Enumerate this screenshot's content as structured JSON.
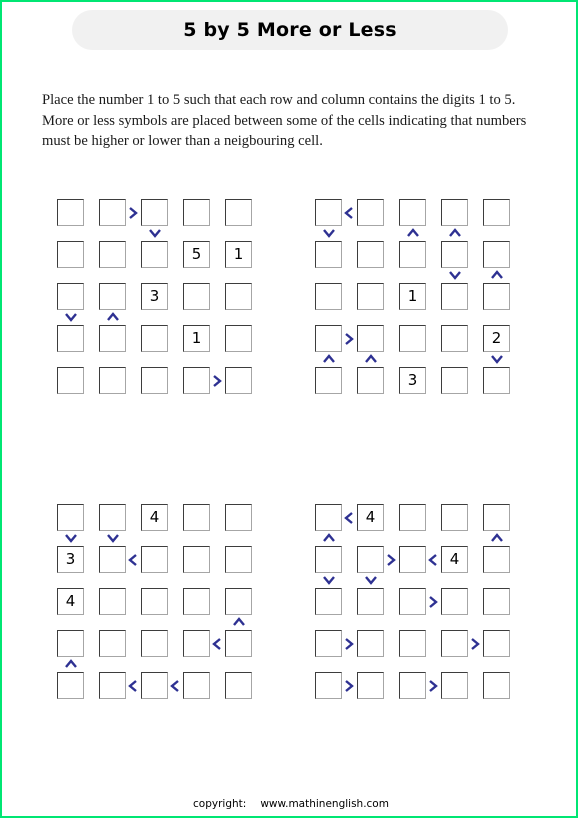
{
  "page": {
    "border_color": "#00e673",
    "background": "#ffffff"
  },
  "title": {
    "text": "5 by 5 More or Less",
    "pill_color": "#f1f1f1"
  },
  "instructions": {
    "text": "Place the number 1 to 5 such that each row and column contains the digits 1 to 5. More or less symbols are placed between some of the cells indicating that numbers must be higher or lower than a neigbouring cell."
  },
  "symbol_color": "#2e3192",
  "cell_border_color": "#3d3d3d",
  "footer": {
    "copyright_label": "copyright:",
    "site": "www.mathinenglish.com"
  },
  "puzzles": [
    {
      "id": "puzzle-top-left",
      "size": 5,
      "values": [
        [
          "",
          "",
          "",
          "",
          ""
        ],
        [
          "",
          "",
          "",
          "5",
          "1"
        ],
        [
          "",
          "",
          "3",
          "",
          ""
        ],
        [
          "",
          "",
          "",
          "1",
          ""
        ],
        [
          "",
          "",
          "",
          "",
          ""
        ]
      ],
      "h_symbols": [
        {
          "row": 0,
          "col": 1,
          "sym": "greater"
        },
        {
          "row": 4,
          "col": 3,
          "sym": "greater"
        }
      ],
      "v_symbols": [
        {
          "row": 0,
          "col": 2,
          "sym": "greater"
        },
        {
          "row": 2,
          "col": 0,
          "sym": "greater"
        },
        {
          "row": 2,
          "col": 1,
          "sym": "less"
        }
      ]
    },
    {
      "id": "puzzle-top-right",
      "size": 5,
      "values": [
        [
          "",
          "",
          "",
          "",
          ""
        ],
        [
          "",
          "",
          "",
          "",
          ""
        ],
        [
          "",
          "",
          "1",
          "",
          ""
        ],
        [
          "",
          "",
          "",
          "",
          "2"
        ],
        [
          "",
          "",
          "3",
          "",
          ""
        ]
      ],
      "h_symbols": [
        {
          "row": 0,
          "col": 0,
          "sym": "less"
        },
        {
          "row": 3,
          "col": 0,
          "sym": "greater"
        }
      ],
      "v_symbols": [
        {
          "row": 0,
          "col": 0,
          "sym": "greater"
        },
        {
          "row": 0,
          "col": 2,
          "sym": "less"
        },
        {
          "row": 0,
          "col": 3,
          "sym": "less"
        },
        {
          "row": 1,
          "col": 3,
          "sym": "greater"
        },
        {
          "row": 1,
          "col": 4,
          "sym": "less"
        },
        {
          "row": 3,
          "col": 0,
          "sym": "less"
        },
        {
          "row": 3,
          "col": 1,
          "sym": "less"
        },
        {
          "row": 3,
          "col": 4,
          "sym": "greater"
        }
      ]
    },
    {
      "id": "puzzle-bottom-left",
      "size": 5,
      "values": [
        [
          "",
          "",
          "4",
          "",
          ""
        ],
        [
          "3",
          "",
          "",
          "",
          ""
        ],
        [
          "4",
          "",
          "",
          "",
          ""
        ],
        [
          "",
          "",
          "",
          "",
          ""
        ],
        [
          "",
          "",
          "",
          "",
          ""
        ]
      ],
      "h_symbols": [
        {
          "row": 1,
          "col": 1,
          "sym": "less"
        },
        {
          "row": 3,
          "col": 3,
          "sym": "less"
        },
        {
          "row": 4,
          "col": 1,
          "sym": "less"
        },
        {
          "row": 4,
          "col": 2,
          "sym": "less"
        }
      ],
      "v_symbols": [
        {
          "row": 0,
          "col": 0,
          "sym": "greater"
        },
        {
          "row": 0,
          "col": 1,
          "sym": "greater"
        },
        {
          "row": 2,
          "col": 4,
          "sym": "less"
        },
        {
          "row": 3,
          "col": 0,
          "sym": "less"
        }
      ]
    },
    {
      "id": "puzzle-bottom-right",
      "size": 5,
      "values": [
        [
          "",
          "4",
          "",
          "",
          ""
        ],
        [
          "",
          "",
          "",
          "4",
          ""
        ],
        [
          "",
          "",
          "",
          "",
          ""
        ],
        [
          "",
          "",
          "",
          "",
          ""
        ],
        [
          "",
          "",
          "",
          "",
          ""
        ]
      ],
      "h_symbols": [
        {
          "row": 0,
          "col": 0,
          "sym": "less"
        },
        {
          "row": 1,
          "col": 1,
          "sym": "greater"
        },
        {
          "row": 1,
          "col": 2,
          "sym": "less"
        },
        {
          "row": 2,
          "col": 2,
          "sym": "greater"
        },
        {
          "row": 3,
          "col": 0,
          "sym": "greater"
        },
        {
          "row": 3,
          "col": 3,
          "sym": "greater"
        },
        {
          "row": 4,
          "col": 0,
          "sym": "greater"
        },
        {
          "row": 4,
          "col": 2,
          "sym": "greater"
        }
      ],
      "v_symbols": [
        {
          "row": 0,
          "col": 0,
          "sym": "less"
        },
        {
          "row": 0,
          "col": 4,
          "sym": "less"
        },
        {
          "row": 1,
          "col": 0,
          "sym": "greater"
        },
        {
          "row": 1,
          "col": 1,
          "sym": "greater"
        }
      ]
    }
  ]
}
